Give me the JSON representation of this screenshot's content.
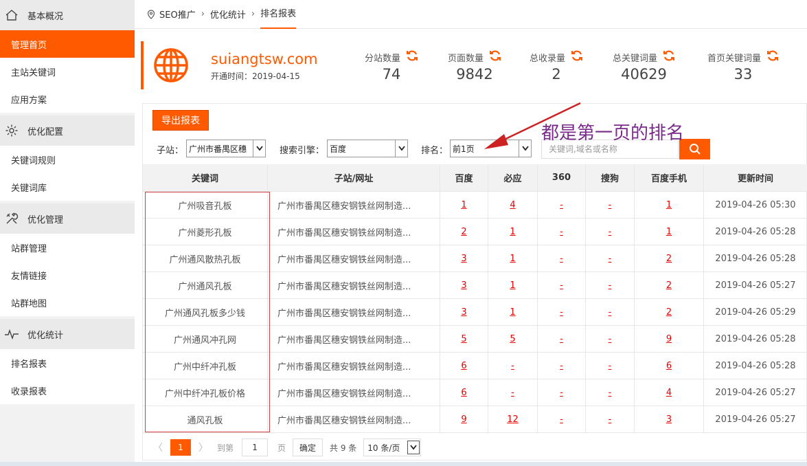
{
  "sidebar": {
    "sections": [
      {
        "title": "基本概况",
        "icon": "home-icon",
        "items": [
          {
            "label": "管理首页",
            "active": true
          },
          {
            "label": "主站关键词"
          },
          {
            "label": "应用方案"
          }
        ]
      },
      {
        "title": "优化配置",
        "icon": "gear-icon",
        "items": [
          {
            "label": "关键词规则"
          },
          {
            "label": "关键词库"
          }
        ]
      },
      {
        "title": "优化管理",
        "icon": "tools-icon",
        "items": [
          {
            "label": "站群管理"
          },
          {
            "label": "友情链接"
          },
          {
            "label": "站群地图"
          }
        ]
      },
      {
        "title": "优化统计",
        "icon": "pulse-icon",
        "items": [
          {
            "label": "排名报表"
          },
          {
            "label": "收录报表"
          }
        ]
      }
    ]
  },
  "breadcrumb": {
    "items": [
      "SEO推广",
      "优化统计",
      "排名报表"
    ]
  },
  "site": {
    "domain": "suiangtsw.com",
    "opened_label": "开通时间：",
    "opened_date": "2019-04-15"
  },
  "stats": [
    {
      "label": "分站数量",
      "value": "74"
    },
    {
      "label": "页面数量",
      "value": "9842"
    },
    {
      "label": "总收录量",
      "value": "2"
    },
    {
      "label": "总关键词量",
      "value": "40629"
    },
    {
      "label": "首页关键词量",
      "value": "33"
    }
  ],
  "toolbar": {
    "export_label": "导出报表"
  },
  "filters": {
    "substation_label": "子站：",
    "substation_value": "广州市番禺区穗",
    "engine_label": "搜索引擎：",
    "engine_value": "百度",
    "rank_label": "排名：",
    "rank_value": "前1页",
    "search_placeholder": "关键词,域名或名称"
  },
  "annotation": {
    "text": "都是第一页的排名"
  },
  "table": {
    "headers": [
      "关键词",
      "子站/网址",
      "百度",
      "必应",
      "360",
      "搜狗",
      "百度手机",
      "更新时间"
    ],
    "rows": [
      {
        "keyword": "广州吸音孔板",
        "site": "广州市番禺区穗安钢铁丝网制造...",
        "baidu": "1",
        "bing": "4",
        "s360": "-",
        "sogou": "-",
        "mobile": "1",
        "time": "2019-04-26 05:30"
      },
      {
        "keyword": "广州菱形孔板",
        "site": "广州市番禺区穗安钢铁丝网制造...",
        "baidu": "2",
        "bing": "1",
        "s360": "-",
        "sogou": "-",
        "mobile": "1",
        "time": "2019-04-26 05:28"
      },
      {
        "keyword": "广州通风散热孔板",
        "site": "广州市番禺区穗安钢铁丝网制造...",
        "baidu": "3",
        "bing": "1",
        "s360": "-",
        "sogou": "-",
        "mobile": "2",
        "time": "2019-04-26 05:28"
      },
      {
        "keyword": "广州通风孔板",
        "site": "广州市番禺区穗安钢铁丝网制造...",
        "baidu": "3",
        "bing": "1",
        "s360": "-",
        "sogou": "-",
        "mobile": "2",
        "time": "2019-04-26 05:27"
      },
      {
        "keyword": "广州通风孔板多少钱",
        "site": "广州市番禺区穗安钢铁丝网制造...",
        "baidu": "3",
        "bing": "1",
        "s360": "-",
        "sogou": "-",
        "mobile": "2",
        "time": "2019-04-26 05:29"
      },
      {
        "keyword": "广州通风冲孔网",
        "site": "广州市番禺区穗安钢铁丝网制造...",
        "baidu": "5",
        "bing": "5",
        "s360": "-",
        "sogou": "-",
        "mobile": "9",
        "time": "2019-04-26 05:28"
      },
      {
        "keyword": "广州中纤冲孔板",
        "site": "广州市番禺区穗安钢铁丝网制造...",
        "baidu": "6",
        "bing": "-",
        "s360": "-",
        "sogou": "-",
        "mobile": "6",
        "time": "2019-04-26 05:28"
      },
      {
        "keyword": "广州中纤冲孔板价格",
        "site": "广州市番禺区穗安钢铁丝网制造...",
        "baidu": "6",
        "bing": "-",
        "s360": "-",
        "sogou": "-",
        "mobile": "4",
        "time": "2019-04-26 05:27"
      },
      {
        "keyword": "通风孔板",
        "site": "广州市番禺区穗安钢铁丝网制造...",
        "baidu": "9",
        "bing": "12",
        "s360": "-",
        "sogou": "-",
        "mobile": "3",
        "time": "2019-04-26 05:27"
      }
    ]
  },
  "pager": {
    "prev": "〈",
    "current": "1",
    "next": "〉",
    "goto_label": "到第",
    "goto_value": "1",
    "page_unit": "页",
    "confirm_label": "确定",
    "total_label": "共 9 条",
    "per_page": "10 条/页"
  },
  "colors": {
    "accent": "#ff5a00",
    "link": "#e60000",
    "annotation": "#7a2a8a"
  }
}
